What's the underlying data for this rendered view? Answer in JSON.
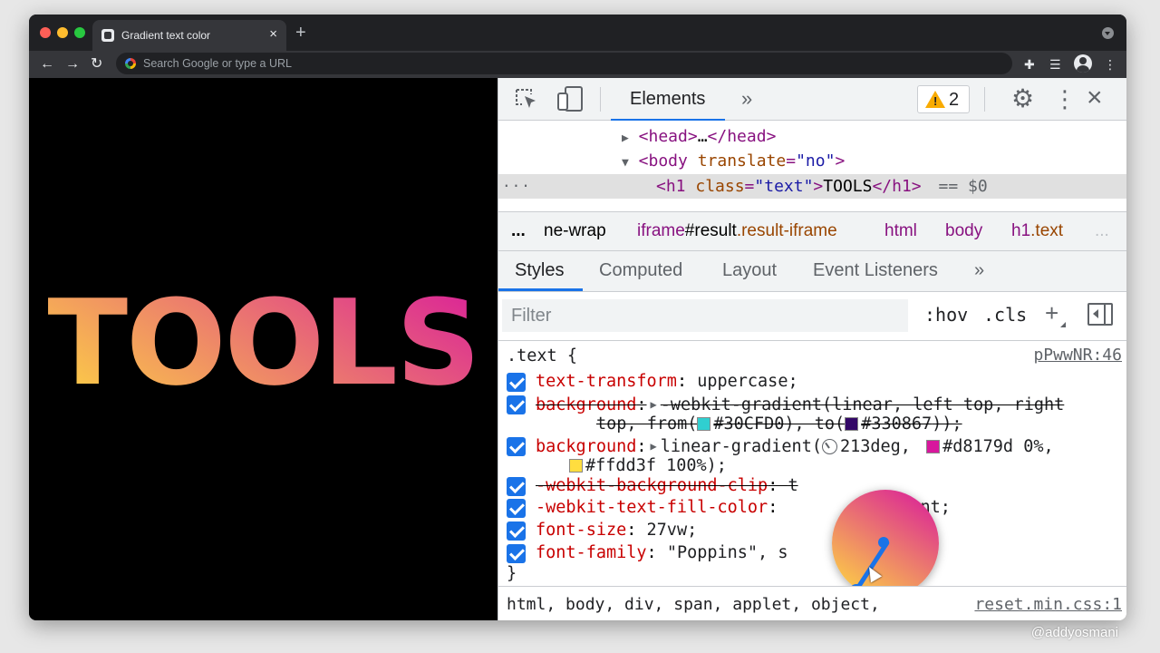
{
  "browser": {
    "tab_title": "Gradient text color",
    "tab_close": "×",
    "new_tab": "+",
    "omnibox_placeholder": "Search Google or type a URL",
    "back": "←",
    "forward": "→",
    "reload": "↻"
  },
  "page": {
    "heading": "TOOLS",
    "gradient": {
      "angle": "213deg",
      "start": "#d8179d",
      "end": "#ffdd3f"
    }
  },
  "devtools": {
    "tabs": {
      "elements": "Elements",
      "more": "»"
    },
    "warnings_count": "2",
    "dom": {
      "head_open": "<head>",
      "head_ellipsis": "…",
      "head_close": "</head>",
      "body_tag": "<body",
      "body_attr": "translate",
      "body_attr_val": "\"no\"",
      "h1_tag_open": "<h1",
      "h1_attr": "class",
      "h1_attr_val": "\"text\"",
      "h1_text": "TOOLS",
      "h1_close": "</h1>",
      "selected_marker": "== $0",
      "ellipsis": "..."
    },
    "breadcrumbs": {
      "ellipsis": "...",
      "item1": "ne-wrap",
      "item2_tag": "iframe",
      "item2_id": "#result",
      "item2_cls": ".result-iframe",
      "item3": "html",
      "item4": "body",
      "item5_tag": "h1",
      "item5_cls": ".text",
      "overflow": "..."
    },
    "style_tabs": [
      "Styles",
      "Computed",
      "Layout",
      "Event Listeners"
    ],
    "style_tabs_more": "»",
    "filter_placeholder": "Filter",
    "hov": ":hov",
    "cls": ".cls",
    "plus": "+",
    "rule": {
      "selector": ".text {",
      "source": "pPwwNR:46",
      "close": "}",
      "decls": {
        "d1_prop": "text-transform",
        "d1_val": "uppercase;",
        "d2_prop": "background",
        "d2_val_a": "-webkit-gradient(linear, left top, right",
        "d2_val_b1": "top, from(",
        "d2_color1": "#30CFD0",
        "d2_val_b2": "), to(",
        "d2_color2": "#330867",
        "d2_val_b3": "));",
        "d3_prop": "background",
        "d3_val_a": "linear-gradient(",
        "d3_angle": "213deg,",
        "d3_color1": "#d8179d",
        "d3_stop1": "0%,",
        "d3_color2": "#ffdd3f",
        "d3_stop2": "100%);",
        "d4_prop": "-webkit-background-clip",
        "d4_val": "t",
        "d5_prop": "-webkit-text-fill-color",
        "d5_val": "ent;",
        "d6_prop": "font-size",
        "d6_val": "27vw;",
        "d7_prop": "font-family",
        "d7_val": "\"Poppins\", s"
      }
    },
    "bottom_rule": {
      "selector": "html, body, div, span, applet, object,",
      "source": "reset.min.css:1"
    }
  },
  "colors": {
    "swatch_30cfd0": "#30cfd0",
    "swatch_330867": "#330867",
    "swatch_d8179d": "#d8179d",
    "swatch_ffdd3f": "#ffdd3f",
    "accent": "#1a73e8"
  },
  "watermark": "@addyosmani"
}
